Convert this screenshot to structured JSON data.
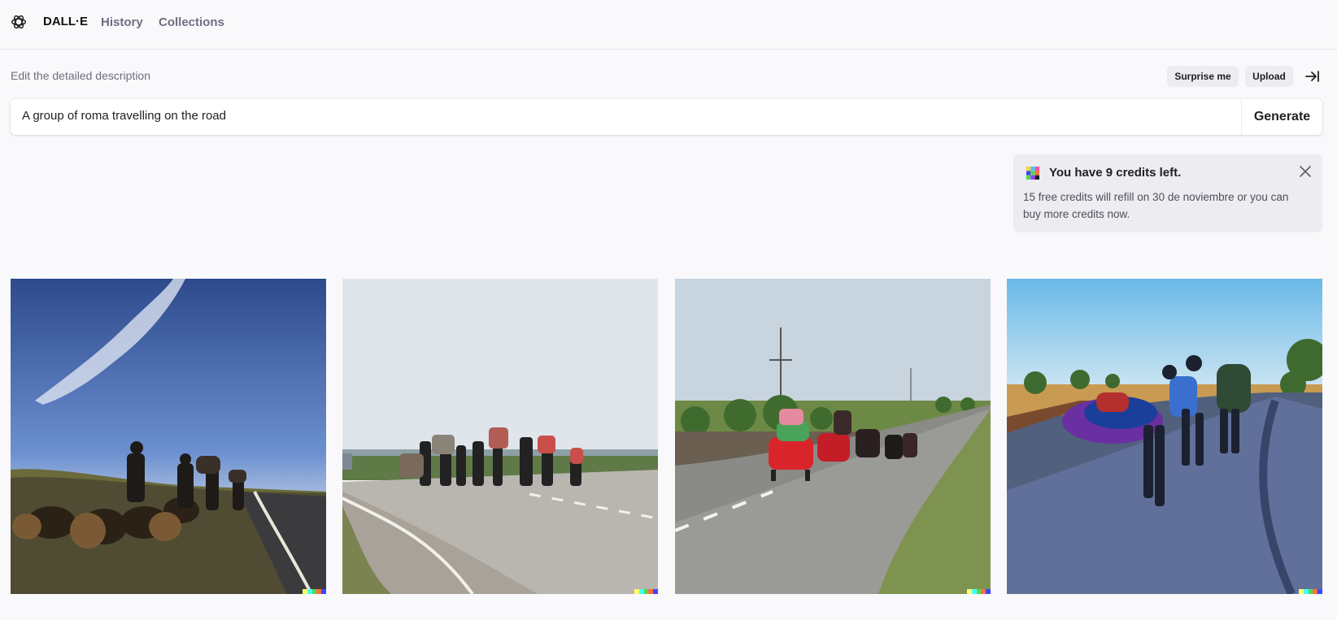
{
  "header": {
    "brand": "DALL·E",
    "nav": [
      "History",
      "Collections"
    ]
  },
  "editor": {
    "label": "Edit the detailed description",
    "surprise_label": "Surprise me",
    "upload_label": "Upload",
    "prompt_value": "A group of roma travelling on the road",
    "generate_label": "Generate"
  },
  "credits": {
    "title": "You have 9 credits left.",
    "body": "15 free credits will refill on 30 de noviembre or you can buy more credits now."
  },
  "colors": {
    "accent": "#202123",
    "muted": "#6e6e80",
    "signature": [
      "#ffff66",
      "#42ffff",
      "#51da4c",
      "#ff6e3c",
      "#3c46ff"
    ]
  }
}
